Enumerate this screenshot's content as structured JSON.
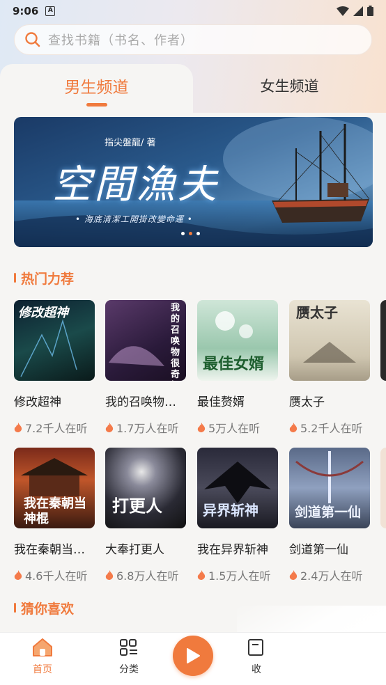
{
  "status_bar": {
    "time": "9:06",
    "notif_icon": "A"
  },
  "search": {
    "placeholder": "查找书籍（书名、作者）"
  },
  "tabs": [
    {
      "label": "男生频道",
      "active": true
    },
    {
      "label": "女生频道",
      "active": false
    }
  ],
  "banner": {
    "author": "指尖盤龍/ 著",
    "title": "空間漁夫",
    "subtitle": "• 海底清潔工開掛改變命運 •",
    "dots": 3,
    "active_dot": 1
  },
  "hot": {
    "title": "热门力荐",
    "books": [
      {
        "name": "修改超神",
        "listeners": "7.2千人在听",
        "cover_text": "修改超神"
      },
      {
        "name": "我的召唤物…",
        "listeners": "1.7万人在听",
        "cover_text": "我的召唤物很奇怪"
      },
      {
        "name": "最佳赘婿",
        "listeners": "5万人在听",
        "cover_text": "最佳女婿"
      },
      {
        "name": "赝太子",
        "listeners": "5.2千人在听",
        "cover_text": "赝太子"
      },
      {
        "name": "我在秦朝当…",
        "listeners": "4.6千人在听",
        "cover_text": "我在秦朝当神棍"
      },
      {
        "name": "大奉打更人",
        "listeners": "6.8万人在听",
        "cover_text": "打更人"
      },
      {
        "name": "我在异界斩神",
        "listeners": "1.5万人在听",
        "cover_text": "异界斩神"
      },
      {
        "name": "剑道第一仙",
        "listeners": "2.4万人在听",
        "cover_text": "剑道第一仙"
      }
    ]
  },
  "guess": {
    "title": "猜你喜欢"
  },
  "nav": [
    {
      "label": "首页",
      "active": true
    },
    {
      "label": "分类"
    },
    {
      "label": "收"
    }
  ],
  "colors": {
    "accent": "#f07a3d"
  }
}
